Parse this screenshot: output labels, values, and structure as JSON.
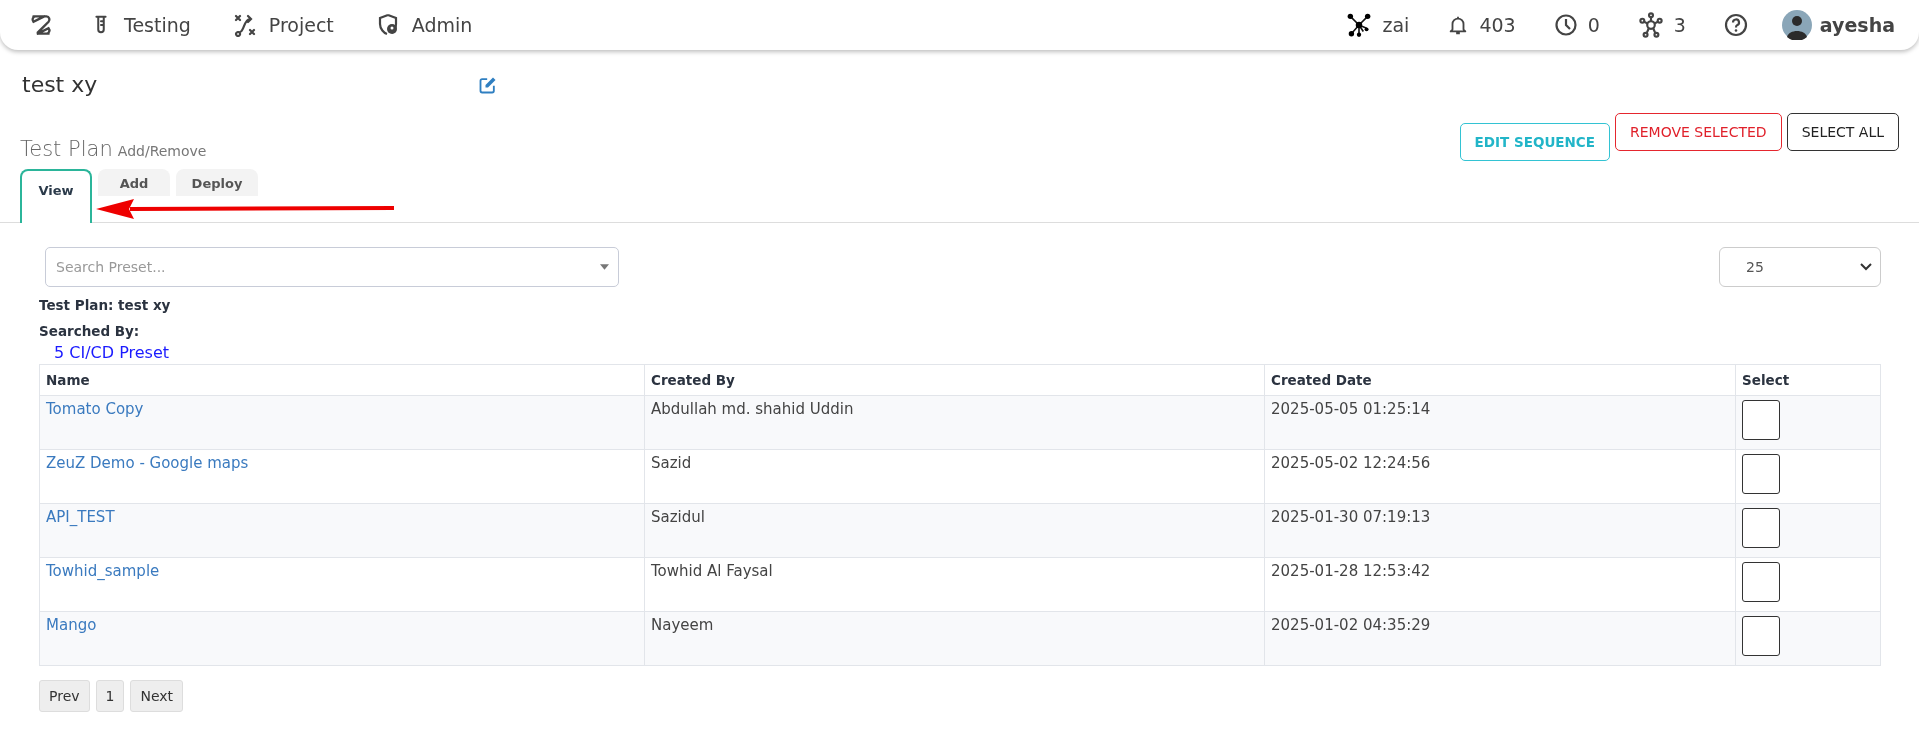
{
  "nav": {
    "items": [
      "Testing",
      "Project",
      "Admin"
    ],
    "status": [
      "zai",
      "403",
      "0",
      "3"
    ],
    "user": "ayesha"
  },
  "plan_title": "test xy",
  "section": {
    "title": "Test Plan",
    "subtitle": "Add/Remove"
  },
  "actions": [
    {
      "label": "EDIT SEQUENCE",
      "kind": "info"
    },
    {
      "label": "REMOVE SELECTED",
      "kind": "danger"
    },
    {
      "label": "SELECT ALL",
      "kind": "default"
    }
  ],
  "tabs": [
    {
      "label": "View",
      "selected": true
    },
    {
      "label": "Add",
      "selected": false
    },
    {
      "label": "Deploy",
      "selected": false
    }
  ],
  "search": {
    "placeholder": "Search Preset..."
  },
  "page_size": "25",
  "info": {
    "plan": "Test Plan: test xy",
    "searched_by": "Searched By:",
    "preset_link": "5 CI/CD Preset"
  },
  "table": {
    "columns": [
      "Name",
      "Created By",
      "Created Date",
      "Select"
    ],
    "rows": [
      {
        "name": "Tomato Copy",
        "created_by": "Abdullah md. shahid Uddin",
        "created_date": "2025-05-05 01:25:14",
        "checked": false
      },
      {
        "name": "ZeuZ Demo - Google maps",
        "created_by": "Sazid",
        "created_date": "2025-05-02 12:24:56",
        "checked": false
      },
      {
        "name": "API_TEST",
        "created_by": "Sazidul",
        "created_date": "2025-01-30 07:19:13",
        "checked": false
      },
      {
        "name": "Towhid_sample",
        "created_by": "Towhid Al Faysal",
        "created_date": "2025-01-28 12:53:42",
        "checked": false
      },
      {
        "name": "Mango",
        "created_by": "Nayeem",
        "created_date": "2025-01-02 04:35:29",
        "checked": false
      }
    ]
  },
  "pagination": [
    "Prev",
    "1",
    "Next"
  ]
}
